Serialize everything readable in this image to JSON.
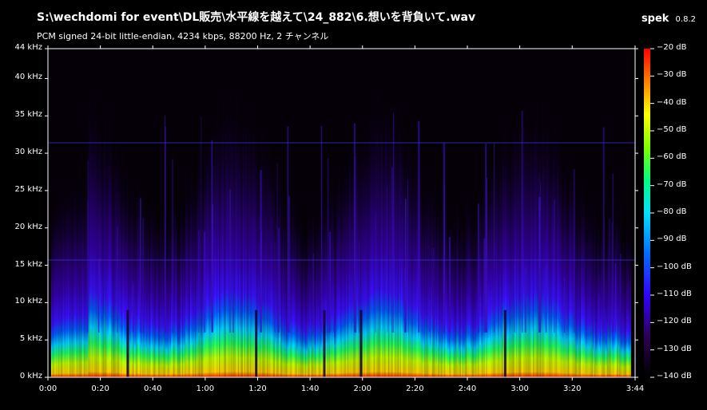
{
  "window": {
    "title": "S:\\wechdomi for event\\DL販売\\水平線を越えて\\24_882\\6.想いを背負いて.wav",
    "subtitle": "PCM signed 24-bit little-endian, 4234 kbps, 88200 Hz, 2 チャンネル",
    "app_name": "spek",
    "app_version": "0.8.2"
  },
  "colors": {
    "background": "#000000",
    "axis": "#ffffff"
  },
  "chart_data": {
    "type": "heatmap",
    "title": "",
    "xlabel": "",
    "ylabel": "",
    "frequency_ticks": [
      "44 kHz",
      "40 kHz",
      "35 kHz",
      "30 kHz",
      "25 kHz",
      "20 kHz",
      "15 kHz",
      "10 kHz",
      "5 kHz",
      "0 kHz"
    ],
    "frequency_values_khz": [
      44,
      40,
      35,
      30,
      25,
      20,
      15,
      10,
      5,
      0
    ],
    "time_ticks": [
      "0:00",
      "0:20",
      "0:40",
      "1:00",
      "1:20",
      "1:40",
      "2:00",
      "2:20",
      "2:40",
      "3:00",
      "3:20",
      "3:44"
    ],
    "time_values_s": [
      0,
      20,
      40,
      60,
      80,
      100,
      120,
      140,
      160,
      180,
      200,
      224
    ],
    "xlim_s": [
      0,
      224
    ],
    "ylim_khz": [
      0,
      44
    ],
    "db_scale_labels": [
      "−20 dB",
      "−30 dB",
      "−40 dB",
      "−50 dB",
      "−60 dB",
      "−70 dB",
      "−80 dB",
      "−90 dB",
      "−100 dB",
      "−110 dB",
      "−120 dB",
      "−130 dB",
      "−140 dB"
    ],
    "db_range": [
      -140,
      -20
    ],
    "colormap": [
      "#000000",
      "#1a0030",
      "#3a0090",
      "#3300ff",
      "#0070ff",
      "#00e0ff",
      "#00ff80",
      "#80ff00",
      "#ffff00",
      "#ff8000",
      "#ff0000"
    ]
  }
}
